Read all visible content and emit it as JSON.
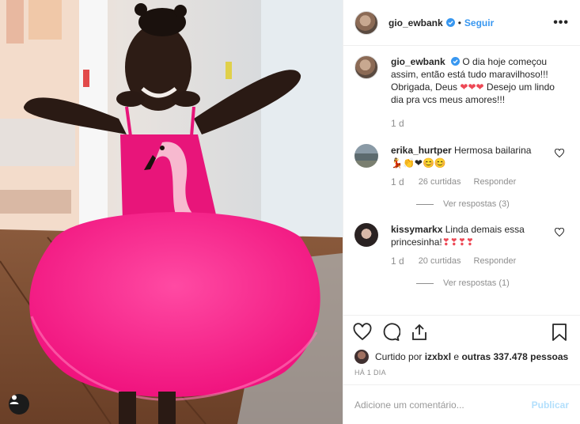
{
  "post": {
    "username": "gio_ewbank",
    "follow_label": "Seguir",
    "dot": "•",
    "more_label": "•••"
  },
  "caption": {
    "username": "gio_ewbank",
    "text_1": "O dia hoje começou assim, então está tudo maravilhoso!!! Obrigada, Deus ",
    "hearts": "❤❤❤",
    "text_2": " Desejo um lindo dia pra vcs meus amores!!!",
    "time": "1 d"
  },
  "comments": [
    {
      "username": "erika_hurtper",
      "text": "Hermosa bailarina",
      "emojis": "💃👏❤😊😊",
      "time": "1 d",
      "likes": "26 curtidas",
      "reply": "Responder",
      "view_replies": "Ver respostas (3)"
    },
    {
      "username": "kissymarkx",
      "text": "Linda demais essa princesinha!",
      "emojis": "❣❣❣❣",
      "time": "1 d",
      "likes": "20 curtidas",
      "reply": "Responder",
      "view_replies": "Ver respostas (1)"
    }
  ],
  "likes": {
    "prefix": "Curtido por ",
    "user": "izxbxl",
    "middle": " e ",
    "others": "outras 337.478 pessoas"
  },
  "posted_ago": "HÁ 1 DIA",
  "comment_box": {
    "placeholder": "Adicione um comentário...",
    "publish_label": "Publicar"
  },
  "colors": {
    "accent": "#3897f0",
    "publish_disabled": "#b2dffc",
    "heart": "#ed4956",
    "tutu": "#ff2d8f",
    "muted": "#8e8e8e"
  }
}
